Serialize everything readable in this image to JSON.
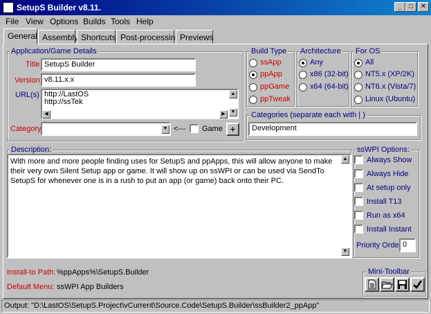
{
  "window": {
    "title": "SetupS Builder v8.11.",
    "controls": {
      "minimize": "_",
      "maximize": "□",
      "close": "✕"
    }
  },
  "menu": [
    "File",
    "View",
    "Options",
    "Builds",
    "Tools",
    "Help"
  ],
  "tabs": [
    "General",
    "Assembly",
    "Shortcuts",
    "Post-processing",
    "Previews"
  ],
  "details": {
    "legend": "Application/Game Details",
    "title_label": "Title",
    "title_value": "SetupS Builder",
    "version_label": "Version",
    "version_value": "v8.11.x.x",
    "urls_label": "URL(s)",
    "urls_value": "http://LastOS\nhttp://ssTek",
    "category_label": "Category",
    "category_value": "",
    "arrow_text": "<---",
    "game_label": "Game",
    "add_button": "+"
  },
  "build_type": {
    "legend": "Build Type",
    "options": [
      "ssApp",
      "ppApp",
      "ppGame",
      "ppTweak"
    ],
    "selected": "ppApp"
  },
  "architecture": {
    "legend": "Architecture",
    "options": [
      "Any",
      "x86 (32-bit)",
      "x64 (64-bit)"
    ],
    "selected": "Any"
  },
  "for_os": {
    "legend": "For OS",
    "options": [
      "All",
      "NT5.x (XP/2K)",
      "NT6.x (Vista/7)",
      "Linux (Ubuntu)"
    ],
    "selected": "All"
  },
  "categories": {
    "legend": "Categories (separate each with | )",
    "value": "Development"
  },
  "description": {
    "legend": "Description:",
    "text": "With more and more people finding uses for SetupS and ppApps, this will allow anyone to make their very own Silent Setup app or game. It will show up on ssWPI or can be used via SendTo SetupS for whenever one is in a rush to put an app (or game) back onto their PC."
  },
  "sswpi": {
    "legend": "ssWPI Options:",
    "options": [
      "Always Show",
      "Always Hide",
      "At setup only",
      "Install T13",
      "Run as x64",
      "Install Instant"
    ],
    "priority_label": "Priority Order",
    "priority_value": "0"
  },
  "paths": {
    "install_label": "Install-to Path:",
    "install_value": "%ppApps%\\SetupS.Builder",
    "menu_label": "Default Menu:",
    "menu_value": "ssWPI App Builders"
  },
  "toolbar": {
    "legend": "Mini-Toolbar",
    "icons": [
      "new-document-icon",
      "open-folder-icon",
      "save-disk-icon",
      "checkmark-icon"
    ]
  },
  "status": {
    "output": "Output:  \"D:\\LastOS\\SetupS.Project\\vCurrent\\Source.Code\\SetupS.Builder\\ssBuilder2_ppApp\""
  }
}
